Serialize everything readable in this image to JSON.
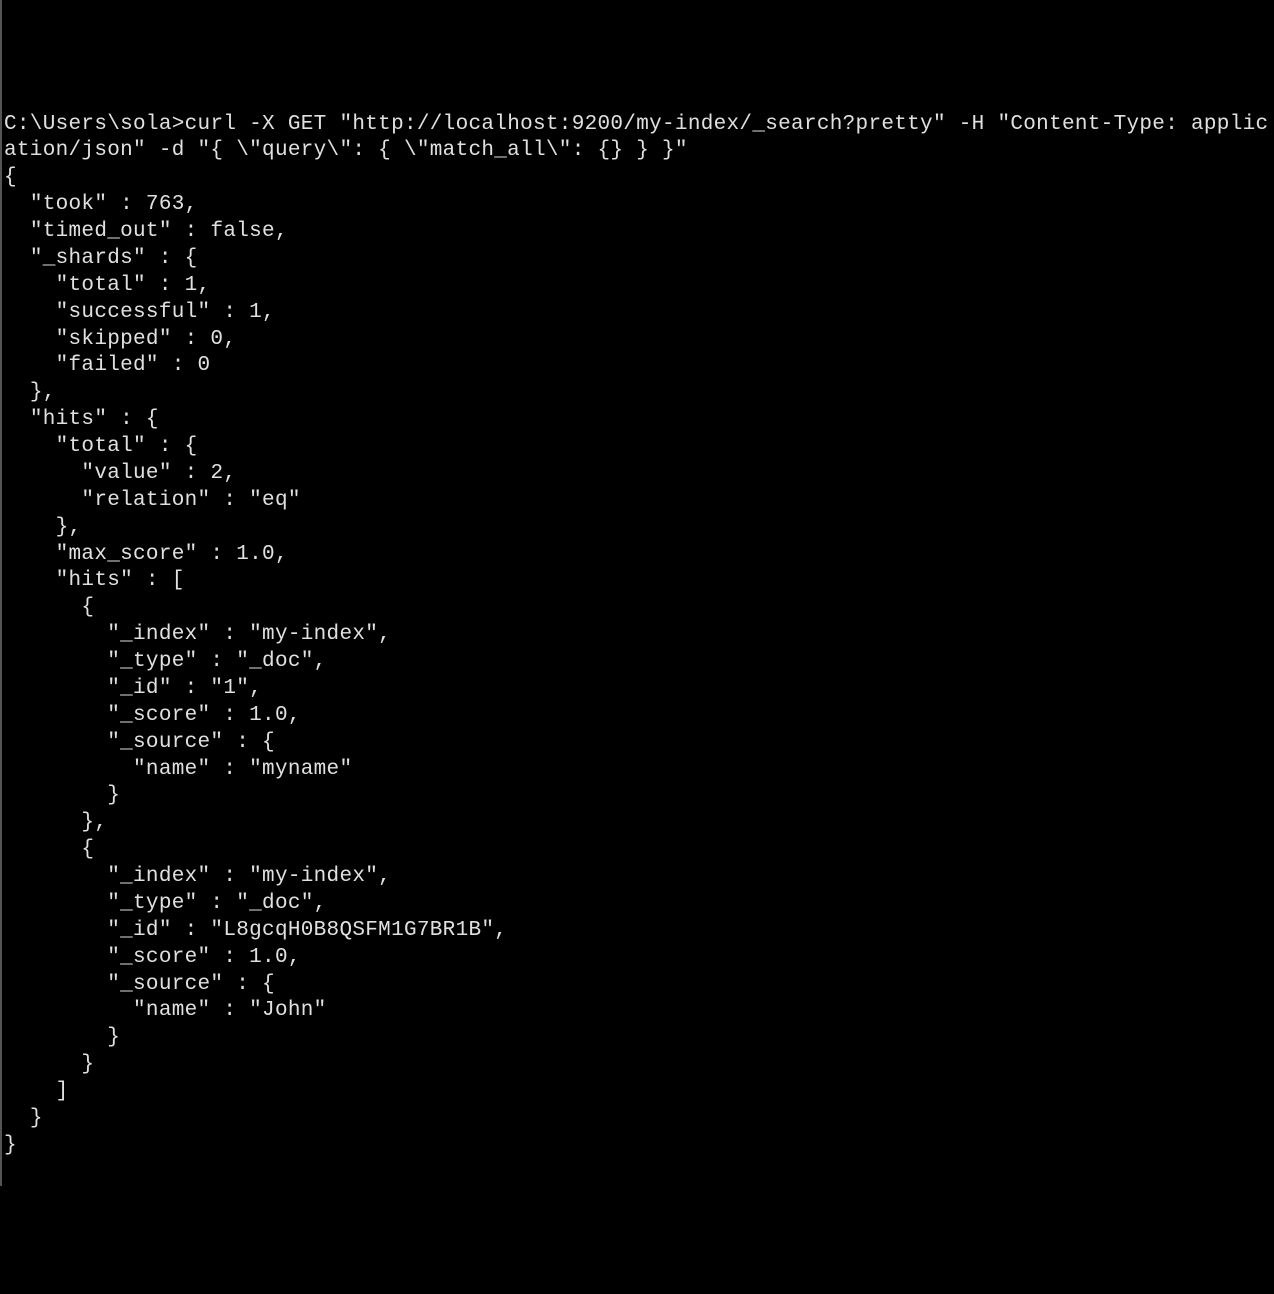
{
  "prompt": "C:\\Users\\sola>",
  "command": "curl -X GET \"http://localhost:9200/my-index/_search?pretty\" -H \"Content-Type: application/json\" -d \"{ \\\"query\\\": { \\\"match_all\\\": {} } }\"",
  "response": {
    "took": 763,
    "timed_out": false,
    "_shards": {
      "total": 1,
      "successful": 1,
      "skipped": 0,
      "failed": 0
    },
    "hits": {
      "total": {
        "value": 2,
        "relation": "eq"
      },
      "max_score": 1.0,
      "hits": [
        {
          "_index": "my-index",
          "_type": "_doc",
          "_id": "1",
          "_score": 1.0,
          "_source": {
            "name": "myname"
          }
        },
        {
          "_index": "my-index",
          "_type": "_doc",
          "_id": "L8gcqH0B8QSFM1G7BR1B",
          "_score": 1.0,
          "_source": {
            "name": "John"
          }
        }
      ]
    }
  },
  "output_lines": [
    "{",
    "  \"took\" : 763,",
    "  \"timed_out\" : false,",
    "  \"_shards\" : {",
    "    \"total\" : 1,",
    "    \"successful\" : 1,",
    "    \"skipped\" : 0,",
    "    \"failed\" : 0",
    "  },",
    "  \"hits\" : {",
    "    \"total\" : {",
    "      \"value\" : 2,",
    "      \"relation\" : \"eq\"",
    "    },",
    "    \"max_score\" : 1.0,",
    "    \"hits\" : [",
    "      {",
    "        \"_index\" : \"my-index\",",
    "        \"_type\" : \"_doc\",",
    "        \"_id\" : \"1\",",
    "        \"_score\" : 1.0,",
    "        \"_source\" : {",
    "          \"name\" : \"myname\"",
    "        }",
    "      },",
    "      {",
    "        \"_index\" : \"my-index\",",
    "        \"_type\" : \"_doc\",",
    "        \"_id\" : \"L8gcqH0B8QSFM1G7BR1B\",",
    "        \"_score\" : 1.0,",
    "        \"_source\" : {",
    "          \"name\" : \"John\"",
    "        }",
    "      }",
    "    ]",
    "  }",
    "}"
  ]
}
